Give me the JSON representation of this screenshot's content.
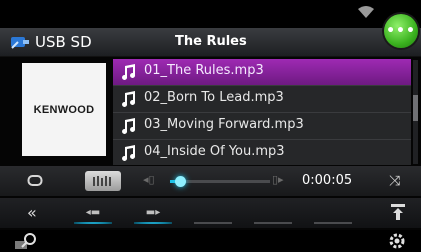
{
  "header": {
    "source_label": "USB SD",
    "title": "The Rules",
    "chat_icon": "speech-bubble-icon"
  },
  "artwork": {
    "brand": "KENWOOD"
  },
  "playlist": {
    "tracks": [
      "01_The Rules.mp3",
      "02_Born To Lead.mp3",
      "03_Moving Forward.mp3",
      "04_Inside Of You.mp3"
    ],
    "active_index": 0
  },
  "playback": {
    "time": "0:00:05",
    "progress_fraction": 0.1,
    "icons": [
      "repeat-icon",
      "browse-list-icon",
      "previous-icon",
      "next-icon",
      "shuffle-icon"
    ]
  },
  "function_bar": {
    "icons": [
      "collapse-icon",
      "folder-previous-icon",
      "folder-next-icon",
      "eject-icon"
    ]
  },
  "bottom": {
    "icons": [
      "search-icon",
      "settings-gear-icon"
    ]
  },
  "colors": {
    "accent": "#1ec3e8",
    "selected_row": "#8a24a0",
    "chat_green": "#3bb21f"
  }
}
